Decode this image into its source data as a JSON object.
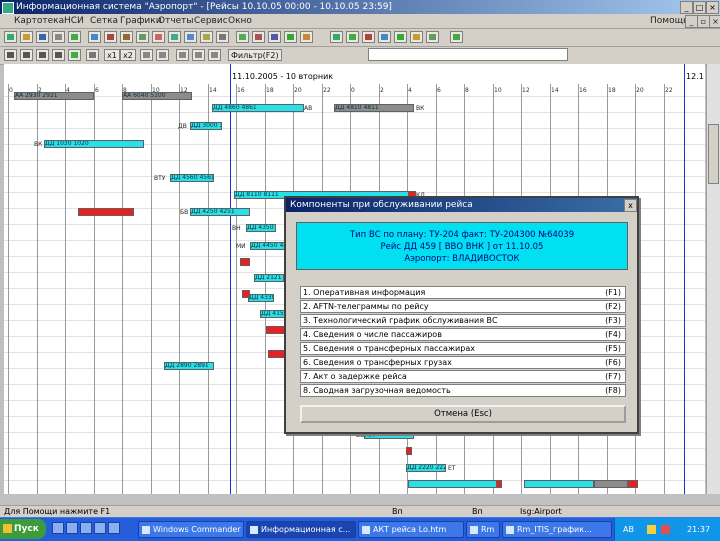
{
  "window": {
    "title": "Информационная система \"Аэропорт\" - [Рейсы 10.10.05 00:00 - 10.10.05 23:59]"
  },
  "menu": {
    "items": [
      "Картотека",
      "НСИ",
      "Сетка",
      "Графики",
      "Отчеты",
      "Сервис",
      "Окно"
    ],
    "right_label": "Помощь"
  },
  "toolbar2": {
    "zoom_labels": [
      "x1",
      "x2"
    ],
    "filter_label": "Фильтр(F2)"
  },
  "gantt": {
    "date_left": "11.10.2005 - 10 вторник",
    "date_right": "12.1",
    "hour_ticks": [
      "0",
      "2",
      "4",
      "6",
      "8",
      "10",
      "12",
      "14",
      "16",
      "18",
      "20",
      "22",
      "0",
      "2",
      "4",
      "6",
      "8",
      "10",
      "12",
      "14",
      "16",
      "18",
      "20",
      "22"
    ],
    "flights": [
      {
        "text": "АА 2930 2931",
        "kind": "g",
        "label": ""
      },
      {
        "text": "АА 6040 5100",
        "kind": "g",
        "label": ""
      },
      {
        "text": "ДД 4860 4861",
        "kind": "c",
        "label": "АВ"
      },
      {
        "text": "ДД 4810 4811",
        "kind": "g",
        "label": "ВК"
      },
      {
        "text": "ДД 3000 3001",
        "kind": "c",
        "label": "ДВ"
      },
      {
        "text": "ДД 1030 1020",
        "kind": "c",
        "label": "ВК"
      },
      {
        "text": "ДД 4560 4561",
        "kind": "c",
        "label": "ВТУ"
      },
      {
        "text": "ДД 8110 8111",
        "kind": "c",
        "label": "КД"
      },
      {
        "text": "ДД 4250 4251",
        "kind": "c",
        "label": "БВ"
      },
      {
        "text": "ДД 4350 4351",
        "kind": "c",
        "label": "ВН"
      },
      {
        "text": "ДД 4450 4451",
        "kind": "c",
        "label": "МИ"
      },
      {
        "text": "ДД 2121 2120",
        "kind": "c",
        "label": ""
      },
      {
        "text": "ДД 4330 4331",
        "kind": "c",
        "label": ""
      },
      {
        "text": "ДД 4150 4151",
        "kind": "c",
        "label": ""
      },
      {
        "text": "ДД 2890 2891",
        "kind": "c",
        "label": ""
      },
      {
        "text": "ДД 2000 2001",
        "kind": "c",
        "label": "ВВ"
      },
      {
        "text": "ДД 2220 2221",
        "kind": "c",
        "label": "ЕТ"
      }
    ]
  },
  "dialog": {
    "title": "Компоненты при обслуживании рейса",
    "close": "x",
    "info_lines": [
      "Тип ВС по плану: ТУ-204 факт: ТУ-204300 №64039",
      "Рейс ДД 459 [ ВВО ВНК ] от 11.10.05",
      "Аэропорт: ВЛАДИВОСТОК"
    ],
    "options": [
      {
        "label": "1. Оперативная информация",
        "key": "(F1)"
      },
      {
        "label": "2. АFTN-телеграммы по рейсу",
        "key": "(F2)"
      },
      {
        "label": "3. Технологический график обслуживания ВС",
        "key": "(F3)"
      },
      {
        "label": "4. Сведения о числе пассажиров",
        "key": "(F4)"
      },
      {
        "label": "5. Сведения о трансферных пассажирах",
        "key": "(F5)"
      },
      {
        "label": "6. Сведения о трансферных грузах",
        "key": "(F6)"
      },
      {
        "label": "7. Акт о задержке рейса",
        "key": "(F7)"
      },
      {
        "label": "8. Сводная загрузочная ведомость",
        "key": "(F8)"
      }
    ],
    "cancel": "Отмена (Esc)"
  },
  "status": {
    "help": "Для Помощи нажмите F1",
    "field1": "Вп",
    "field2": "Вп",
    "field3": "Isg:Airport"
  },
  "taskbar": {
    "start": "Пуск",
    "tasks": [
      "Windows Commander 5.1...",
      "Информационная с...",
      "АКТ рейса Lo.htm",
      "Rm",
      "Rm_ITIS_график..."
    ],
    "tray_lang": "AB",
    "clock": "21:37"
  },
  "colors": {
    "cyan": "#28e0e8",
    "red": "#e82020",
    "grey": "#8c8c8c",
    "title_blue": "#0a246a",
    "taskbar_blue": "#245edb"
  }
}
